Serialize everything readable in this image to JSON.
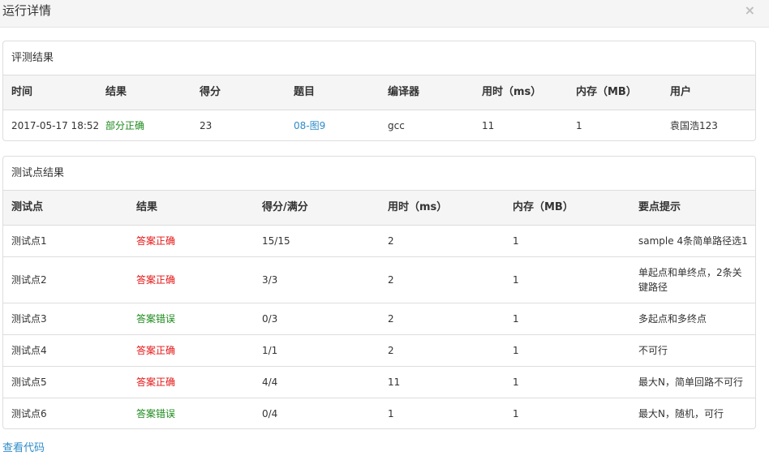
{
  "modal": {
    "title": "运行详情",
    "close_label": "×"
  },
  "result_panel": {
    "title": "评测结果",
    "headers": [
      "时间",
      "结果",
      "得分",
      "题目",
      "编译器",
      "用时（ms）",
      "内存（MB）",
      "用户"
    ],
    "row": {
      "time": "2017-05-17 18:52",
      "result": "部分正确",
      "score": "23",
      "problem": "08-图9",
      "compiler": "gcc",
      "time_ms": "11",
      "memory_mb": "1",
      "user": "袁国浩123"
    }
  },
  "testcase_panel": {
    "title": "测试点结果",
    "headers": [
      "测试点",
      "结果",
      "得分/满分",
      "用时（ms）",
      "内存（MB）",
      "要点提示"
    ],
    "rows": [
      {
        "name": "测试点1",
        "result": "答案正确",
        "score": "15/15",
        "time": "2",
        "memory": "1",
        "hint": "sample 4条简单路径选1"
      },
      {
        "name": "测试点2",
        "result": "答案正确",
        "score": "3/3",
        "time": "2",
        "memory": "1",
        "hint": "单起点和单终点，2条关键路径"
      },
      {
        "name": "测试点3",
        "result": "答案错误",
        "score": "0/3",
        "time": "2",
        "memory": "1",
        "hint": "多起点和多终点"
      },
      {
        "name": "测试点4",
        "result": "答案正确",
        "score": "1/1",
        "time": "2",
        "memory": "1",
        "hint": "不可行"
      },
      {
        "name": "测试点5",
        "result": "答案正确",
        "score": "4/4",
        "time": "11",
        "memory": "1",
        "hint": "最大N，简单回路不可行"
      },
      {
        "name": "测试点6",
        "result": "答案错误",
        "score": "0/4",
        "time": "1",
        "memory": "1",
        "hint": "最大N，随机，可行"
      }
    ]
  },
  "footer": {
    "view_code_label": "查看代码"
  },
  "colors": {
    "partial": "#1c8a1c",
    "accepted": "#e41515",
    "wrong": "#1c8a1c",
    "link": "#2f8cc8"
  }
}
